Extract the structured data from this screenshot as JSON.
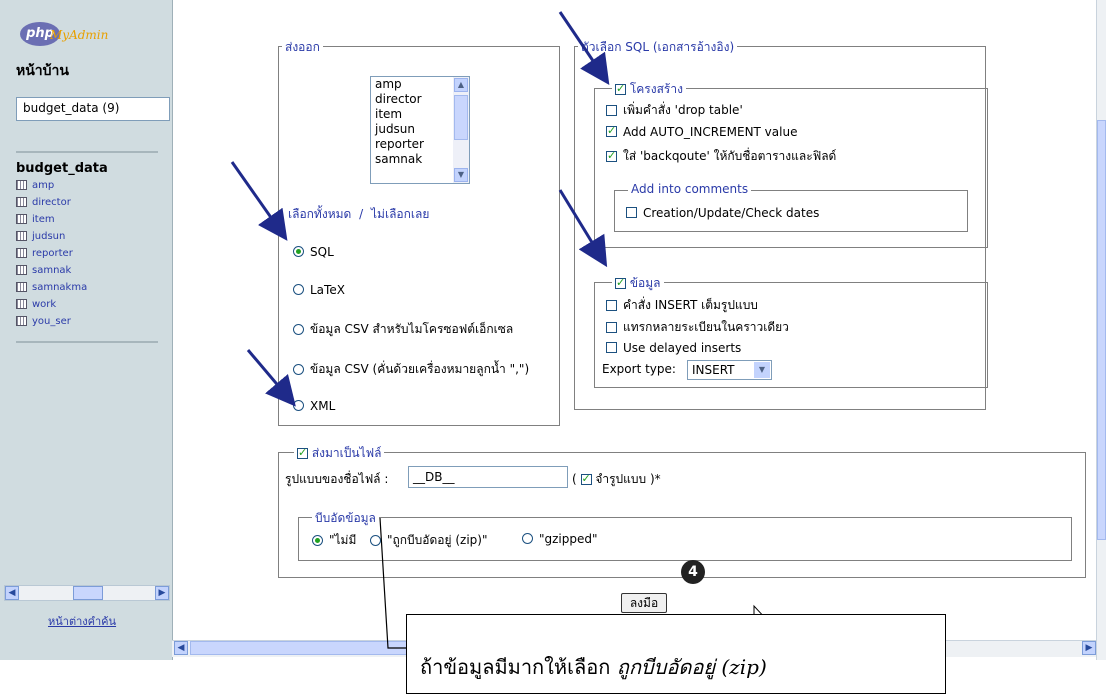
{
  "left": {
    "logo_php": "php",
    "logo_myadmin": "MyAdmin",
    "home": "หน้าบ้าน",
    "db_select": "budget_data (9)",
    "db_name": "budget_data",
    "tables": [
      "amp",
      "director",
      "item",
      "judsun",
      "reporter",
      "samnak",
      "samnakma",
      "work",
      "you_ser"
    ],
    "query_window": "หน้าต่างคำค้น"
  },
  "export": {
    "legend": "ส่งออก",
    "table_list": [
      "amp",
      "director",
      "item",
      "judsun",
      "reporter",
      "samnak"
    ],
    "select_all": "เลือกทั้งหมด",
    "separator": "/",
    "select_none": "ไม่เลือกเลย",
    "formats": [
      {
        "label": "SQL",
        "selected": true
      },
      {
        "label": "LaTeX",
        "selected": false
      },
      {
        "label": "ข้อมูล CSV สำหรับไมโครซอฟต์เอ็กเซล",
        "selected": false
      },
      {
        "label": "ข้อมูล CSV (คั่นด้วยเครื่องหมายลูกน้ำ \",\")",
        "selected": false
      },
      {
        "label": "XML",
        "selected": false
      }
    ]
  },
  "sql_options": {
    "legend": "ตัวเลือก SQL (เอกสารอ้างอิง)",
    "structure": {
      "legend": "โครงสร้าง",
      "checked": true,
      "options": [
        {
          "label": "เพิ่มคำสั่ง 'drop table'",
          "checked": false
        },
        {
          "label": "Add AUTO_INCREMENT value",
          "checked": true
        },
        {
          "label": "ใส่ 'backqoute' ให้กับชื่อตารางและฟิลด์",
          "checked": true
        }
      ],
      "comments_legend": "Add into comments",
      "comments_option": "Creation/Update/Check dates"
    },
    "data": {
      "legend": "ข้อมูล",
      "checked": true,
      "options": [
        {
          "label": "คำสั่ง INSERT เต็มรูปแบบ",
          "checked": false
        },
        {
          "label": "แทรกหลายระเบียนในคราวเดียว",
          "checked": false
        },
        {
          "label": "Use delayed inserts",
          "checked": false
        }
      ],
      "export_type_label": "Export type:",
      "export_type_value": "INSERT"
    }
  },
  "save_file": {
    "legend": "ส่งมาเป็นไฟล์",
    "filename_label": "รูปแบบของชื่อไฟล์ :",
    "filename_value": "__DB__",
    "remember_open": "(",
    "remember_label": "จำรูปแบบ",
    "remember_close": ")*",
    "compression_legend": "บีบอัดข้อมูล",
    "compression": [
      {
        "label": "\"ไม่มี",
        "selected": true
      },
      {
        "label": "\"ถูกบีบอัดอยู่ (zip)\"",
        "selected": false
      },
      {
        "label": "\"gzipped\"",
        "selected": false
      }
    ]
  },
  "go_button": "ลงมือ",
  "step_marker": "4",
  "callout": {
    "plain": "ถ้าข้อมูลมีมากให้เลือก",
    "italic": "ถูกบีบอัดอยู่ (zip)"
  },
  "colors": {
    "accent": "#2a3aa8",
    "arrow": "#1f2a8a",
    "check": "#21a121"
  }
}
